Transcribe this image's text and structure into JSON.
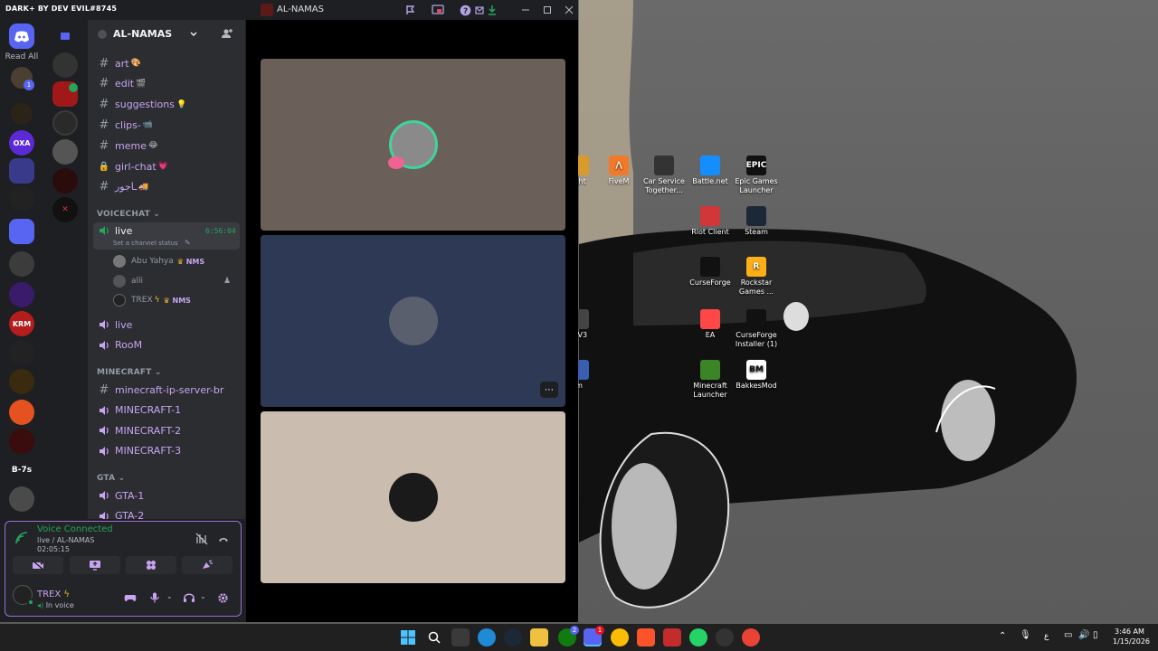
{
  "window": {
    "brand": "DARK+ BY DEV EVIL#8745",
    "title": "AL-NAMAS",
    "buttons": [
      "minimize",
      "maximize",
      "close"
    ]
  },
  "rail": {
    "read_all": "Read All",
    "unread_badge": "1",
    "text_servers": [
      "OXA",
      "KRM",
      "B-7s"
    ]
  },
  "guild": {
    "name": "AL-NAMAS"
  },
  "channels": {
    "text_top": [
      {
        "name": "art",
        "type": "text",
        "emoji": "🎨"
      },
      {
        "name": "edit",
        "type": "text",
        "emoji": "🎬"
      },
      {
        "name": "suggestions",
        "type": "text",
        "emoji": "💡"
      },
      {
        "name": "clips-",
        "type": "text",
        "emoji": "📹"
      },
      {
        "name": "meme",
        "type": "text",
        "emoji": "😂"
      },
      {
        "name": "girl-chat",
        "type": "locked",
        "emoji": "💗"
      },
      {
        "name": "ـاجور",
        "type": "text",
        "emoji": "🚚"
      }
    ],
    "voicechat_category": "VOICECHAT",
    "live_active": {
      "name": "live",
      "timer": "6:56:04",
      "status_hint": "Set a channel status"
    },
    "members": [
      {
        "name": "Abu Yahya",
        "tag": "NMS"
      },
      {
        "name": "alli",
        "tag": ""
      },
      {
        "name": "TREX",
        "tag": "NMS"
      }
    ],
    "voice_more": [
      {
        "name": "live"
      },
      {
        "name": "RooM"
      }
    ],
    "minecraft_category": "MINECRAFT",
    "minecraft": [
      {
        "name": "minecraft-ip-server-br",
        "type": "text"
      },
      {
        "name": "MINECRAFT-1",
        "type": "voice"
      },
      {
        "name": "MINECRAFT-2",
        "type": "voice"
      },
      {
        "name": "MINECRAFT-3",
        "type": "voice"
      }
    ],
    "gta_category": "GTA",
    "gta": [
      {
        "name": "GTA-1"
      },
      {
        "name": "GTA-2"
      }
    ]
  },
  "voice_panel": {
    "status": "Voice Connected",
    "location": "live / AL-NAMAS",
    "elapsed": "02:05:15",
    "user": "TREX",
    "user_status": "In voice"
  },
  "stage": {
    "tiles": [
      {
        "label": "tile-1",
        "bg": "#6b5f59"
      },
      {
        "label": "tile-2",
        "bg": "#2e3a55"
      },
      {
        "label": "tile-3",
        "bg": "#cabdb0"
      }
    ],
    "more_label": "⋯"
  },
  "desktop_icons": [
    {
      "label": "ight",
      "color": "#d89a2a",
      "glyph": ""
    },
    {
      "label": "FiveM",
      "color": "#f07a2a",
      "glyph": "⋀"
    },
    {
      "label": "Car Service Together...",
      "color": "#333333",
      "glyph": ""
    },
    {
      "label": "Battle.net",
      "color": "#148eff",
      "glyph": ""
    },
    {
      "label": "Epic Games Launcher",
      "color": "#111111",
      "glyph": "EPIC"
    },
    {
      "label": "Riot Client",
      "color": "#d13639",
      "glyph": ""
    },
    {
      "label": "Steam",
      "color": "#1b2838",
      "glyph": ""
    },
    {
      "label": "CurseForge",
      "color": "#111111",
      "glyph": ""
    },
    {
      "label": "Rockstar Games ...",
      "color": "#fcaf17",
      "glyph": "R"
    },
    {
      "label": "d V3",
      "color": "#444444",
      "glyph": ""
    },
    {
      "label": "EA",
      "color": "#ff4747",
      "glyph": ""
    },
    {
      "label": "CurseForge Installer (1)",
      "color": "#111111",
      "glyph": ""
    },
    {
      "label": "m",
      "color": "#3b5fb0",
      "glyph": ""
    },
    {
      "label": "Minecraft Launcher",
      "color": "#3c8527",
      "glyph": ""
    },
    {
      "label": "BakkesMod",
      "color": "#ffffff",
      "glyph": "BM"
    }
  ],
  "taskbar": {
    "time": "3:46 AM",
    "date": "1/15/2026",
    "ime": "ع",
    "badges": {
      "xbox": "2",
      "discord": "1"
    }
  }
}
